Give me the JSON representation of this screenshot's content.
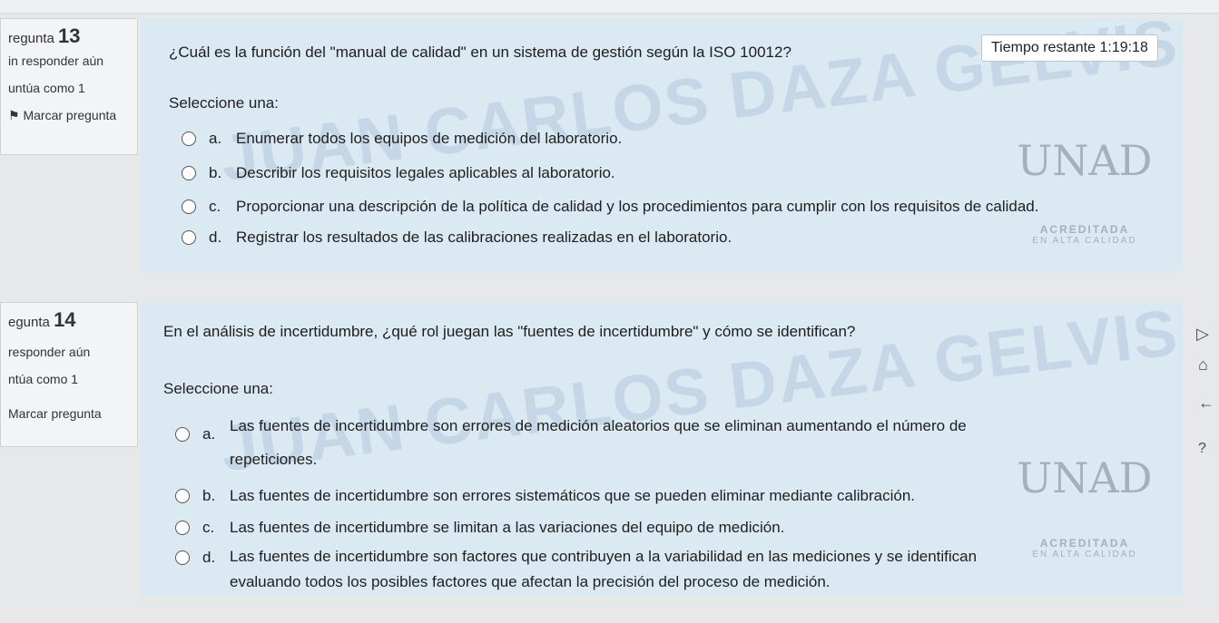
{
  "questions": [
    {
      "number_label": "regunta",
      "number": "13",
      "status": "in responder aún",
      "points": "untúa como 1",
      "flag": "Marcar pregunta",
      "text": "¿Cuál es la función del \"manual de calidad\" en un sistema de gestión según la ISO 10012?",
      "select_label": "Seleccione una:",
      "options": [
        {
          "letter": "a.",
          "text": "Enumerar todos los equipos de medición del laboratorio."
        },
        {
          "letter": "b.",
          "text": "Describir los requisitos legales aplicables al laboratorio."
        },
        {
          "letter": "c.",
          "text": "Proporcionar una descripción de la política de calidad y los procedimientos para cumplir con los requisitos de calidad."
        },
        {
          "letter": "d.",
          "text": "Registrar los resultados de las calibraciones realizadas en el laboratorio."
        }
      ]
    },
    {
      "number_label": "egunta",
      "number": "14",
      "status": "responder aún",
      "points": "ntúa como 1",
      "flag": "Marcar pregunta",
      "text": "En el análisis de incertidumbre, ¿qué rol juegan las \"fuentes de incertidumbre\" y cómo se identifican?",
      "select_label": "Seleccione una:",
      "options": [
        {
          "letter": "a.",
          "text": "Las fuentes de incertidumbre son errores de medición aleatorios que se eliminan aumentando el número de repeticiones."
        },
        {
          "letter": "b.",
          "text": "Las fuentes de incertidumbre son errores sistemáticos que se pueden eliminar mediante calibración."
        },
        {
          "letter": "c.",
          "text": "Las fuentes de incertidumbre se limitan a las variaciones del equipo de medición."
        },
        {
          "letter": "d.",
          "text": "Las fuentes de incertidumbre son factores que contribuyen a la variabilidad en las mediciones y se identifican evaluando todos los posibles factores que afectan la precisión del proceso de medición."
        }
      ]
    }
  ],
  "timer": {
    "label": "Tiempo restante",
    "value": "1:19:18"
  },
  "watermark": {
    "line1": "JUAN CARLOS DAZA GELVIS"
  },
  "logo": {
    "mark": "UNAD",
    "accreditation": "ACREDITADA",
    "accreditation_sub": "EN ALTA CALIDAD"
  },
  "icons": [
    "home-icon",
    "back-arrow-icon",
    "help-icon",
    "cursor-icon"
  ]
}
